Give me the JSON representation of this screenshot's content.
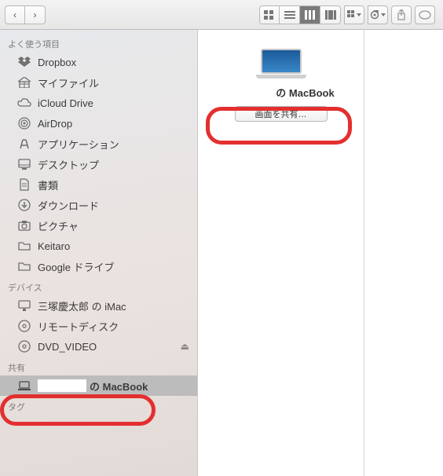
{
  "toolbar": {
    "nav": {
      "back": "‹",
      "forward": "›"
    },
    "view": {
      "icons": "icons",
      "list": "list",
      "columns": "columns",
      "gallery": "gallery"
    },
    "arrange": "arrange",
    "action": "action",
    "share": "share",
    "tags": "tags"
  },
  "sidebar": {
    "sections": [
      {
        "title": "よく使う項目",
        "items": [
          {
            "icon": "dropbox",
            "label": "Dropbox"
          },
          {
            "icon": "home",
            "label": "マイファイル"
          },
          {
            "icon": "cloud",
            "label": "iCloud Drive"
          },
          {
            "icon": "airdrop",
            "label": "AirDrop"
          },
          {
            "icon": "apps",
            "label": "アプリケーション"
          },
          {
            "icon": "desktop",
            "label": "デスクトップ"
          },
          {
            "icon": "docs",
            "label": "書類"
          },
          {
            "icon": "download",
            "label": "ダウンロード"
          },
          {
            "icon": "pictures",
            "label": "ピクチャ"
          },
          {
            "icon": "folder",
            "label": "Keitaro"
          },
          {
            "icon": "folder",
            "label": "Google ドライブ"
          }
        ]
      },
      {
        "title": "デバイス",
        "items": [
          {
            "icon": "imac",
            "label": "三塚慶太郎 の iMac"
          },
          {
            "icon": "disc",
            "label": "リモートディスク"
          },
          {
            "icon": "disc",
            "label": "DVD_VIDEO",
            "eject": true
          }
        ]
      },
      {
        "title": "共有",
        "items": [
          {
            "icon": "laptop",
            "label": "の MacBook",
            "redacted": true,
            "selected": true
          }
        ]
      },
      {
        "title": "タグ",
        "items": []
      }
    ]
  },
  "content": {
    "device_label": "の MacBook",
    "share_button": "画面を共有…"
  }
}
